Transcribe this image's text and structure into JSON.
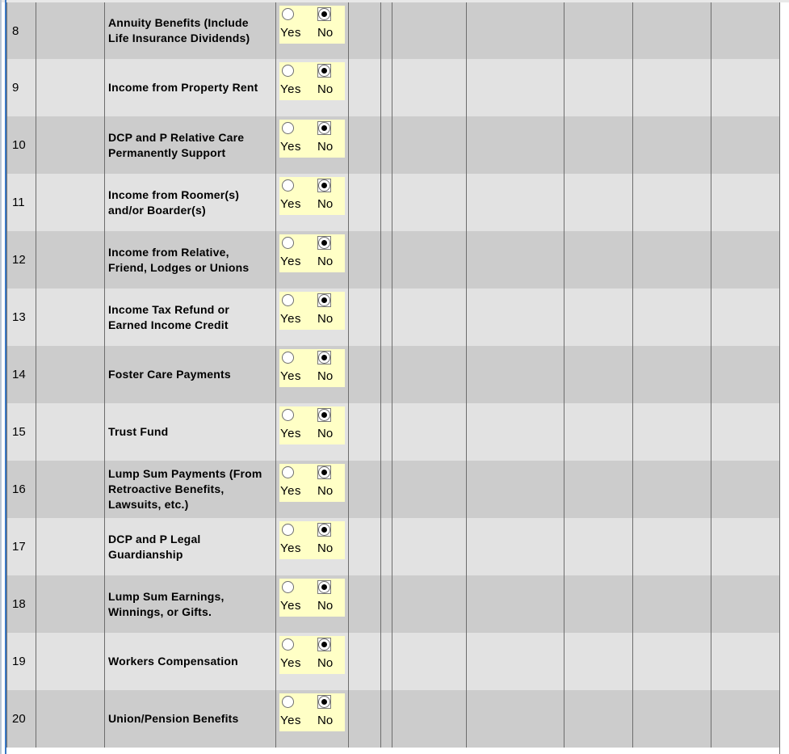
{
  "options": {
    "yes": "Yes",
    "no": "No"
  },
  "rows": [
    {
      "num": "8",
      "label": "Annuity Benefits (Include\nLife Insurance Dividends)",
      "selected": "No"
    },
    {
      "num": "9",
      "label": "Income from Property Rent",
      "selected": "No"
    },
    {
      "num": "10",
      "label": "DCP and P Relative Care\nPermanently Support",
      "selected": "No"
    },
    {
      "num": "11",
      "label": "Income from Roomer(s)\nand/or Boarder(s)",
      "selected": "No"
    },
    {
      "num": "12",
      "label": "Income from Relative,\nFriend, Lodges or Unions",
      "selected": "No"
    },
    {
      "num": "13",
      "label": "Income Tax Refund or\nEarned Income Credit",
      "selected": "No"
    },
    {
      "num": "14",
      "label": "Foster Care Payments",
      "selected": "No"
    },
    {
      "num": "15",
      "label": "Trust Fund",
      "selected": "No"
    },
    {
      "num": "16",
      "label": "Lump Sum Payments (From\nRetroactive Benefits,\nLawsuits, etc.)",
      "selected": "No"
    },
    {
      "num": "17",
      "label": "DCP and P Legal\nGuardianship",
      "selected": "No"
    },
    {
      "num": "18",
      "label": "Lump Sum Earnings,\nWinnings, or Gifts.",
      "selected": "No"
    },
    {
      "num": "19",
      "label": "Workers Compensation",
      "selected": "No"
    },
    {
      "num": "20",
      "label": "Union/Pension Benefits",
      "selected": "No"
    }
  ]
}
